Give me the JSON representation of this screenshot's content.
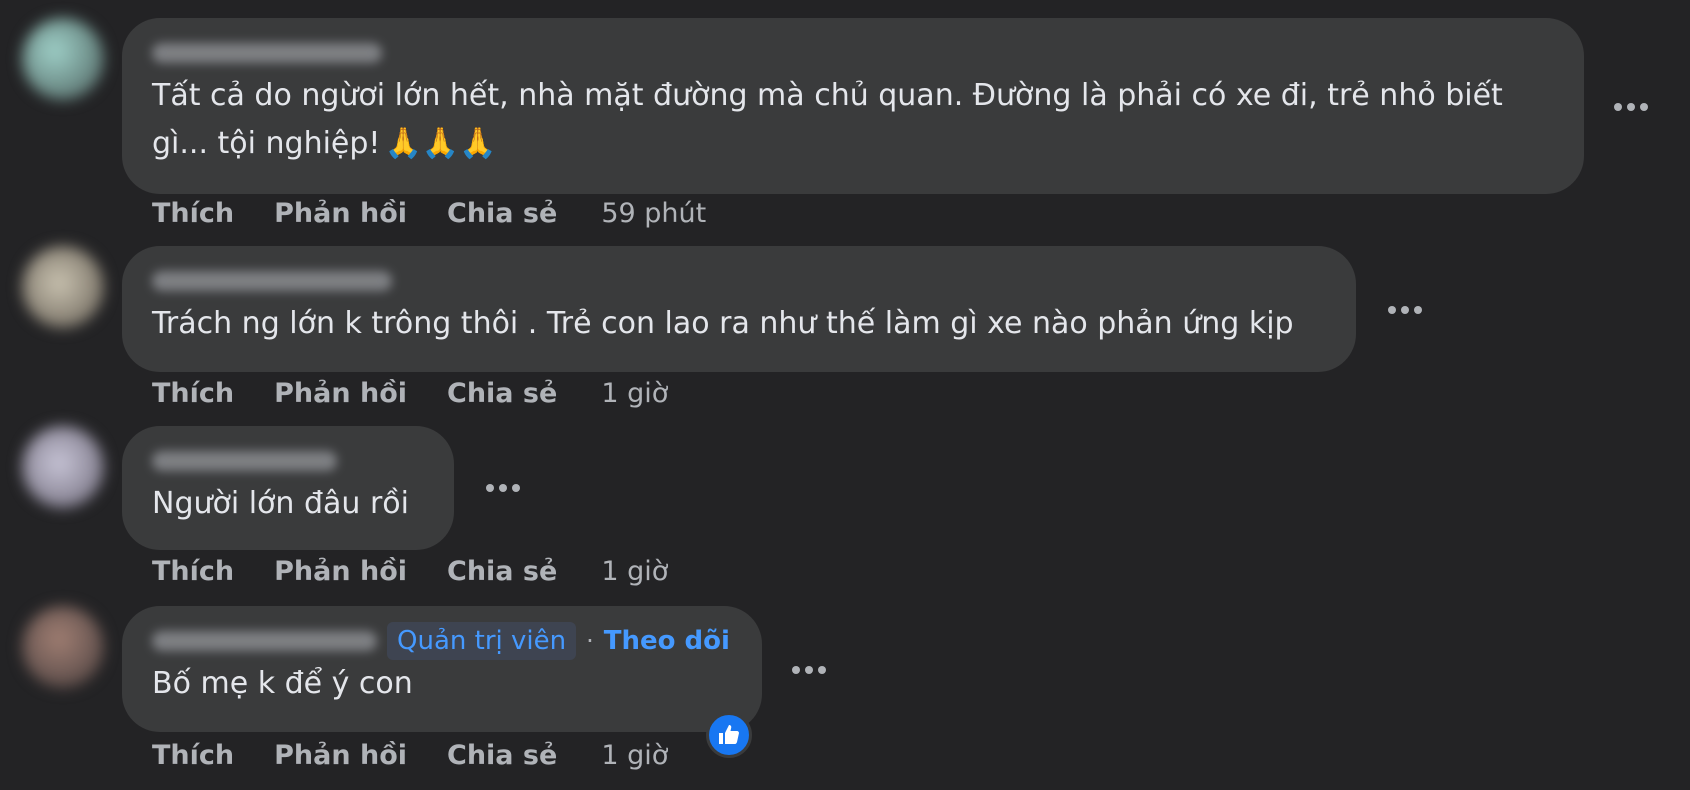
{
  "comments": [
    {
      "text_line1": "Tất cả do ngừơi lớn hết, nhà mặt đường mà chủ quan. Đường là phải có xe đi, trẻ nhỏ biết",
      "text_line2": "gì... tội nghiệp!",
      "emoji": "🙏🙏🙏",
      "actions": {
        "like": "Thích",
        "reply": "Phản hồi",
        "share": "Chia sẻ"
      },
      "time": "59 phút",
      "avatar_color": "#6f8f8a"
    },
    {
      "text_line1": "Trách ng lớn k trông thôi . Trẻ con lao ra như thế làm gì xe nào phản ứng kịp",
      "actions": {
        "like": "Thích",
        "reply": "Phản hồi",
        "share": "Chia sẻ"
      },
      "time": "1 giờ",
      "avatar_color": "#8a8376"
    },
    {
      "text_line1": "Người lớn đâu rồi",
      "actions": {
        "like": "Thích",
        "reply": "Phản hồi",
        "share": "Chia sẻ"
      },
      "time": "1 giờ",
      "avatar_color": "#8e8a9a"
    },
    {
      "text_line1": "Bố mẹ k để ý con",
      "admin_badge": "Quản trị viên",
      "separator": "·",
      "follow": "Theo dõi",
      "actions": {
        "like": "Thích",
        "reply": "Phản hồi",
        "share": "Chia sẻ"
      },
      "time": "1 giờ",
      "avatar_color": "#6e5a55",
      "reaction_icon": "thumbs-up-icon"
    }
  ],
  "colors": {
    "background": "#232325",
    "bubble": "#3a3b3c",
    "link_blue": "#4599ff",
    "like_blue": "#1877f2"
  }
}
